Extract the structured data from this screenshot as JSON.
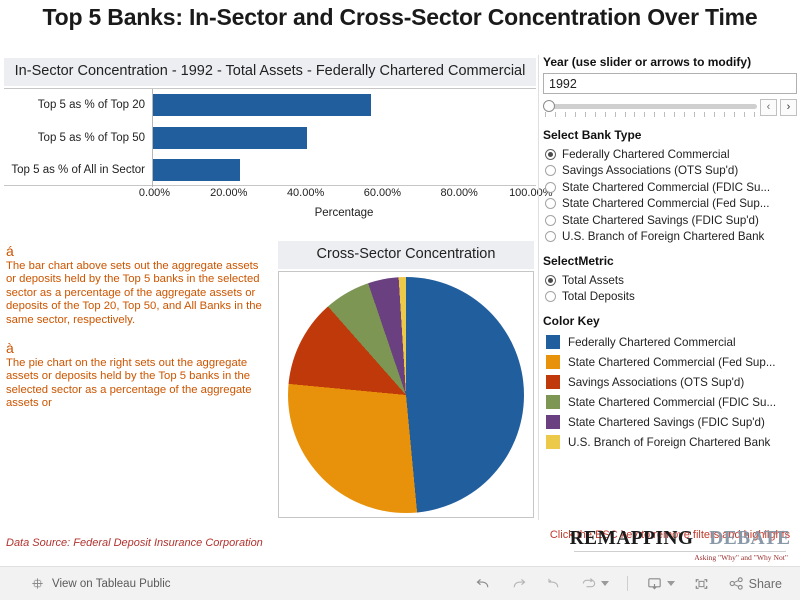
{
  "dashboard": {
    "title": "Top 5 Banks: In-Sector and Cross-Sector Concentration Over Time",
    "data_source": "Data Source: Federal Deposit Insurance Corporation"
  },
  "bar_panel": {
    "caption": "In-Sector Concentration - 1992 - Total Assets - Federally Chartered Commercial"
  },
  "pie_panel": {
    "caption": "Cross-Sector Concentration"
  },
  "notes": [
    {
      "bullet": "á",
      "text": "The bar chart above sets out the aggregate assets or deposits held by the Top 5 banks in the selected sector as a percentage of the aggregate assets or deposits of the Top 20, Top 50, and All Banks in the same sector, respectively."
    },
    {
      "bullet": "à",
      "text": "The pie chart on the right sets out the aggregate assets or deposits held by the Top 5 banks in the selected sector as a percentage of the aggregate assets or"
    }
  ],
  "controls": {
    "year": {
      "heading": "Year (use slider or arrows to modify)",
      "value": "1992",
      "prev_label": "‹",
      "next_label": "›"
    },
    "bank_type": {
      "heading": "Select Bank Type",
      "selected": "Federally Chartered Commercial",
      "options": [
        "Federally Chartered Commercial",
        "Savings Associations (OTS Sup'd)",
        "State Chartered Commercial (FDIC Su...",
        "State Chartered Commercial (Fed Sup...",
        "State Chartered Savings (FDIC Sup'd)",
        "U.S. Branch of Foreign Chartered Bank"
      ]
    },
    "metric": {
      "heading": "SelectMetric",
      "selected": "Total Assets",
      "options": [
        "Total Assets",
        "Total Deposits"
      ]
    },
    "color_key": {
      "heading": "Color Key",
      "items": [
        {
          "label": "Federally Chartered Commercial",
          "color": "#215e9e"
        },
        {
          "label": "State Chartered Commercial (Fed Sup...",
          "color": "#e8920c"
        },
        {
          "label": "Savings Associations (OTS Sup'd)",
          "color": "#c0390a"
        },
        {
          "label": "State Chartered Commercial (FDIC Su...",
          "color": "#7d9653"
        },
        {
          "label": "State Chartered Savings (FDIC Sup'd)",
          "color": "#6a4080"
        },
        {
          "label": "U.S. Branch of Foreign Chartered Bank",
          "color": "#edc94a"
        }
      ]
    },
    "esc_note": "Click the ESC key to remove filters and highlights"
  },
  "logo": {
    "word_one": "REMAPPING",
    "word_two": "DEBATE",
    "tagline": "Asking \"Why\" and \"Why Not\""
  },
  "toolbar": {
    "view_label": "View on Tableau Public",
    "share_label": "Share",
    "icons": [
      "tableau-icon",
      "undo-icon",
      "redo-icon",
      "revert-icon",
      "refresh-icon",
      "pause-caret-icon",
      "download-icon",
      "fullscreen-icon",
      "share-icon"
    ]
  },
  "chart_data": [
    {
      "type": "bar",
      "orientation": "horizontal",
      "title": "In-Sector Concentration - 1992 - Total Assets - Federally Chartered Commercial",
      "categories": [
        "Top 5 as % of Top 20",
        "Top 5 as % of Top 50",
        "Top 5 as % of All in Sector"
      ],
      "values": [
        56.8,
        40.3,
        22.6
      ],
      "xlabel": "Percentage",
      "ylabel": "",
      "xlim": [
        0,
        100
      ],
      "xticks": [
        "0.00%",
        "20.00%",
        "40.00%",
        "60.00%",
        "80.00%",
        "100.00%"
      ],
      "xtick_values": [
        0,
        20,
        40,
        60,
        80,
        100
      ],
      "grid": false,
      "legend": "none",
      "bar_color": "#215e9e"
    },
    {
      "type": "pie",
      "title": "Cross-Sector Concentration",
      "start_angle_deg": 0,
      "direction": "clockwise",
      "labels": [
        "Federally Chartered Commercial",
        "State Chartered Commercial (Fed Sup...",
        "Savings Associations (OTS Sup'd)",
        "State Chartered Commercial (FDIC Su...",
        "State Chartered Savings (FDIC Sup'd)",
        "U.S. Branch of Foreign Chartered Bank"
      ],
      "values": [
        48.5,
        28.0,
        12.0,
        6.3,
        4.2,
        1.0
      ],
      "colors": [
        "#215e9e",
        "#e8920c",
        "#c0390a",
        "#7d9653",
        "#6a4080",
        "#edc94a"
      ],
      "legend": "right",
      "ordering": "clockwise from 12 o'clock: blue, orange, dark-red, green, purple, yellow"
    }
  ]
}
